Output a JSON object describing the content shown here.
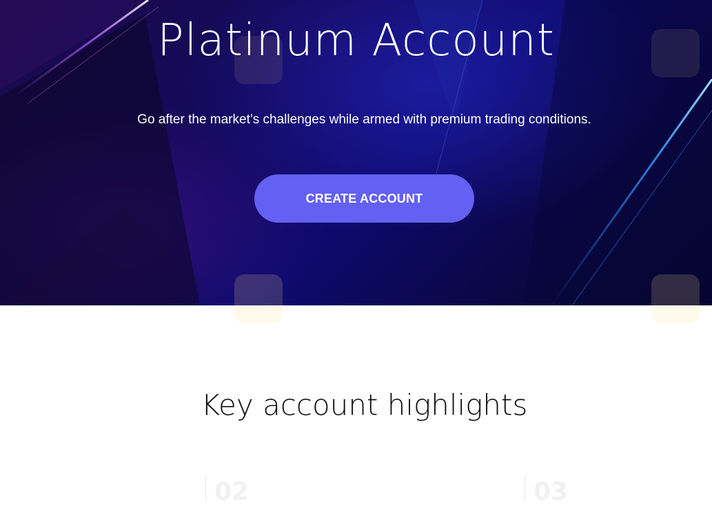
{
  "hero": {
    "title": "Platinum Account",
    "subtitle": "Go after the market’s challenges while armed with premium trading conditions.",
    "cta_label": "CREATE ACCOUNT"
  },
  "highlights": {
    "title": "Key account highlights",
    "cards": [
      {
        "number": ""
      },
      {
        "number": "02"
      },
      {
        "number": "03"
      }
    ]
  },
  "colors": {
    "cta_background": "#6360f3",
    "hero_background": "#120a5a",
    "page_background": "#ffffff"
  }
}
